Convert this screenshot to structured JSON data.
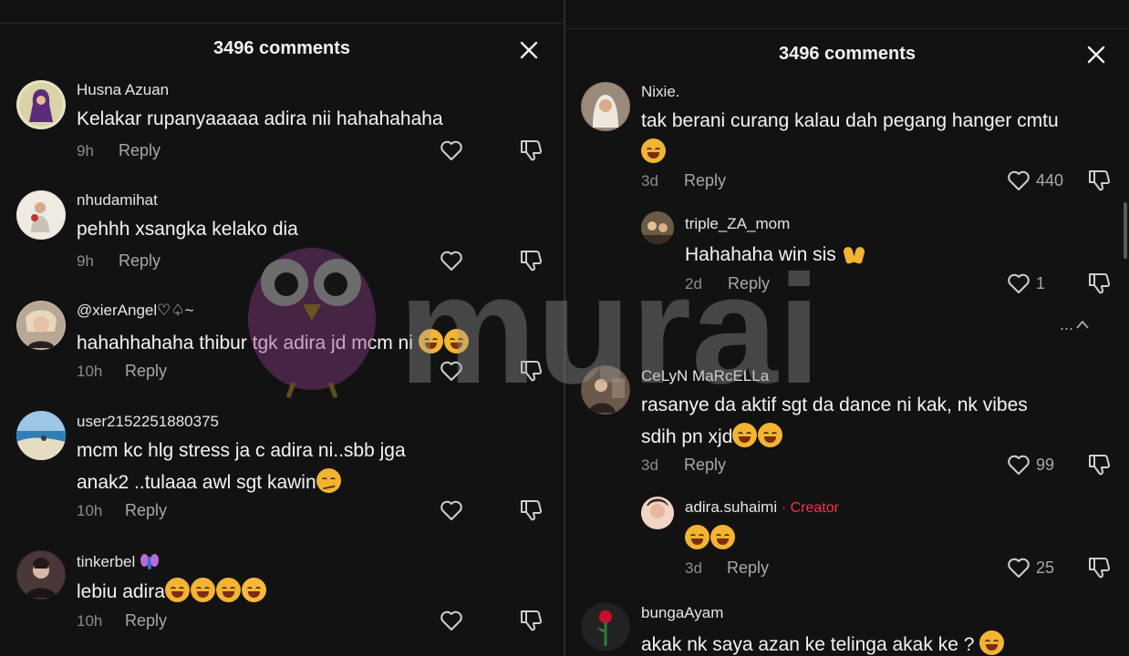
{
  "left_panel": {
    "title": "3496 comments",
    "comments": [
      {
        "username": "Husna Azuan",
        "text": [
          "Kelakar rupanyaaaaa adira nii hahahahaha"
        ],
        "time": "9h",
        "reply": "Reply"
      },
      {
        "username": "nhudamihat",
        "text": [
          "pehhh xsangka kelako dia"
        ],
        "time": "9h",
        "reply": "Reply"
      },
      {
        "username": "@xierAngel♡♤~",
        "text": [
          "hahahhahaha thibur tgk adira jd mcm ni"
        ],
        "time": "10h",
        "reply": "Reply"
      },
      {
        "username": "user2152251880375",
        "text": [
          "mcm kc hlg stress ja c adira ni..sbb jga",
          "anak2 ..tulaaa awl sgt kawin"
        ],
        "time": "10h",
        "reply": "Reply"
      },
      {
        "username": "tinkerbel",
        "text": [
          "lebiu adira"
        ],
        "time": "10h",
        "reply": "Reply"
      }
    ]
  },
  "right_panel": {
    "title": "3496 comments",
    "comments": [
      {
        "username": "Nixie.",
        "text": [
          "tak berani curang kalau dah pegang hanger cmtu"
        ],
        "time": "3d",
        "reply": "Reply",
        "likes": "440"
      },
      {
        "username": "triple_ZA_mom",
        "text": [
          "Hahahaha win sis"
        ],
        "time": "2d",
        "reply": "Reply",
        "likes": "1"
      },
      {
        "username": "CeLyN MaRcELLa",
        "text": [
          "rasanye da aktif sgt da dance ni kak, nk vibes",
          "sdih pn xjd"
        ],
        "time": "3d",
        "reply": "Reply",
        "likes": "99"
      },
      {
        "username": "adira.suhaimi",
        "badge": "· Creator",
        "text": [
          ""
        ],
        "time": "3d",
        "reply": "Reply",
        "likes": "25"
      },
      {
        "username": "bungaAyam",
        "text": [
          "akak nk saya azan ke telinga akak ke ?"
        ]
      }
    ],
    "collapse_text": "..."
  },
  "watermark": {
    "text": "murai"
  },
  "colors": {
    "background": "#121212",
    "accent": "#fe2c55",
    "muted": "#8c8c8c"
  }
}
